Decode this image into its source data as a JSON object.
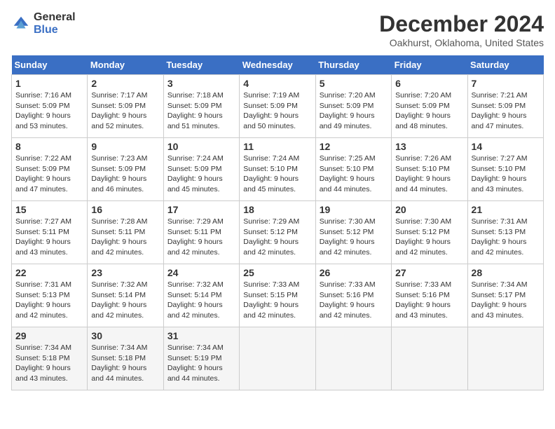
{
  "logo": {
    "general": "General",
    "blue": "Blue"
  },
  "title": "December 2024",
  "subtitle": "Oakhurst, Oklahoma, United States",
  "days_of_week": [
    "Sunday",
    "Monday",
    "Tuesday",
    "Wednesday",
    "Thursday",
    "Friday",
    "Saturday"
  ],
  "weeks": [
    [
      {
        "day": "1",
        "sunrise": "7:16 AM",
        "sunset": "5:09 PM",
        "daylight": "9 hours and 53 minutes."
      },
      {
        "day": "2",
        "sunrise": "7:17 AM",
        "sunset": "5:09 PM",
        "daylight": "9 hours and 52 minutes."
      },
      {
        "day": "3",
        "sunrise": "7:18 AM",
        "sunset": "5:09 PM",
        "daylight": "9 hours and 51 minutes."
      },
      {
        "day": "4",
        "sunrise": "7:19 AM",
        "sunset": "5:09 PM",
        "daylight": "9 hours and 50 minutes."
      },
      {
        "day": "5",
        "sunrise": "7:20 AM",
        "sunset": "5:09 PM",
        "daylight": "9 hours and 49 minutes."
      },
      {
        "day": "6",
        "sunrise": "7:20 AM",
        "sunset": "5:09 PM",
        "daylight": "9 hours and 48 minutes."
      },
      {
        "day": "7",
        "sunrise": "7:21 AM",
        "sunset": "5:09 PM",
        "daylight": "9 hours and 47 minutes."
      }
    ],
    [
      {
        "day": "8",
        "sunrise": "7:22 AM",
        "sunset": "5:09 PM",
        "daylight": "9 hours and 47 minutes."
      },
      {
        "day": "9",
        "sunrise": "7:23 AM",
        "sunset": "5:09 PM",
        "daylight": "9 hours and 46 minutes."
      },
      {
        "day": "10",
        "sunrise": "7:24 AM",
        "sunset": "5:09 PM",
        "daylight": "9 hours and 45 minutes."
      },
      {
        "day": "11",
        "sunrise": "7:24 AM",
        "sunset": "5:10 PM",
        "daylight": "9 hours and 45 minutes."
      },
      {
        "day": "12",
        "sunrise": "7:25 AM",
        "sunset": "5:10 PM",
        "daylight": "9 hours and 44 minutes."
      },
      {
        "day": "13",
        "sunrise": "7:26 AM",
        "sunset": "5:10 PM",
        "daylight": "9 hours and 44 minutes."
      },
      {
        "day": "14",
        "sunrise": "7:27 AM",
        "sunset": "5:10 PM",
        "daylight": "9 hours and 43 minutes."
      }
    ],
    [
      {
        "day": "15",
        "sunrise": "7:27 AM",
        "sunset": "5:11 PM",
        "daylight": "9 hours and 43 minutes."
      },
      {
        "day": "16",
        "sunrise": "7:28 AM",
        "sunset": "5:11 PM",
        "daylight": "9 hours and 42 minutes."
      },
      {
        "day": "17",
        "sunrise": "7:29 AM",
        "sunset": "5:11 PM",
        "daylight": "9 hours and 42 minutes."
      },
      {
        "day": "18",
        "sunrise": "7:29 AM",
        "sunset": "5:12 PM",
        "daylight": "9 hours and 42 minutes."
      },
      {
        "day": "19",
        "sunrise": "7:30 AM",
        "sunset": "5:12 PM",
        "daylight": "9 hours and 42 minutes."
      },
      {
        "day": "20",
        "sunrise": "7:30 AM",
        "sunset": "5:12 PM",
        "daylight": "9 hours and 42 minutes."
      },
      {
        "day": "21",
        "sunrise": "7:31 AM",
        "sunset": "5:13 PM",
        "daylight": "9 hours and 42 minutes."
      }
    ],
    [
      {
        "day": "22",
        "sunrise": "7:31 AM",
        "sunset": "5:13 PM",
        "daylight": "9 hours and 42 minutes."
      },
      {
        "day": "23",
        "sunrise": "7:32 AM",
        "sunset": "5:14 PM",
        "daylight": "9 hours and 42 minutes."
      },
      {
        "day": "24",
        "sunrise": "7:32 AM",
        "sunset": "5:14 PM",
        "daylight": "9 hours and 42 minutes."
      },
      {
        "day": "25",
        "sunrise": "7:33 AM",
        "sunset": "5:15 PM",
        "daylight": "9 hours and 42 minutes."
      },
      {
        "day": "26",
        "sunrise": "7:33 AM",
        "sunset": "5:16 PM",
        "daylight": "9 hours and 42 minutes."
      },
      {
        "day": "27",
        "sunrise": "7:33 AM",
        "sunset": "5:16 PM",
        "daylight": "9 hours and 43 minutes."
      },
      {
        "day": "28",
        "sunrise": "7:34 AM",
        "sunset": "5:17 PM",
        "daylight": "9 hours and 43 minutes."
      }
    ],
    [
      {
        "day": "29",
        "sunrise": "7:34 AM",
        "sunset": "5:18 PM",
        "daylight": "9 hours and 43 minutes."
      },
      {
        "day": "30",
        "sunrise": "7:34 AM",
        "sunset": "5:18 PM",
        "daylight": "9 hours and 44 minutes."
      },
      {
        "day": "31",
        "sunrise": "7:34 AM",
        "sunset": "5:19 PM",
        "daylight": "9 hours and 44 minutes."
      },
      null,
      null,
      null,
      null
    ]
  ]
}
